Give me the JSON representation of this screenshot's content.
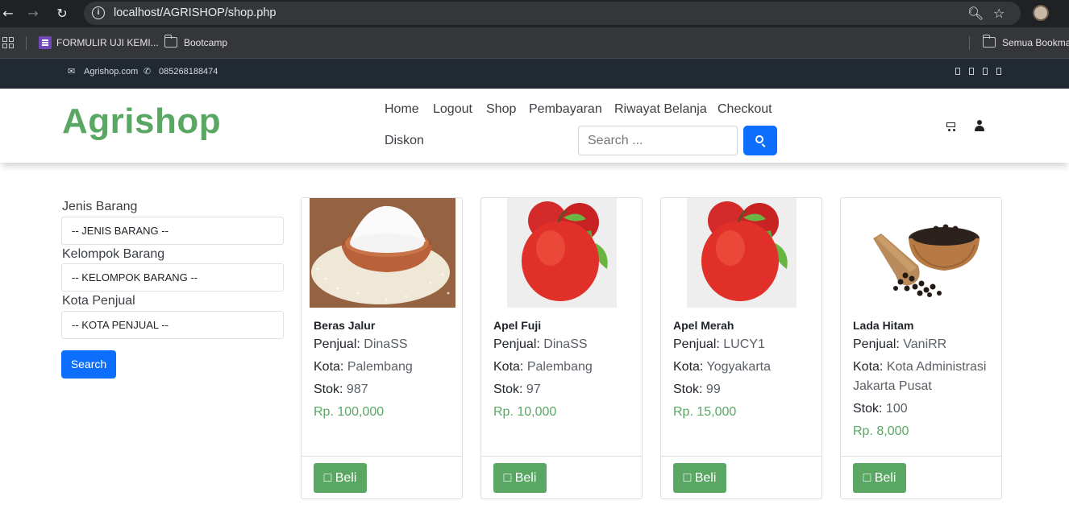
{
  "browser": {
    "url": "localhost/AGRISHOP/shop.php",
    "bookmarks": [
      "FORMULIR UJI KEMI...",
      "Bootcamp"
    ],
    "all_bookmarks": "Semua Bookma"
  },
  "topbar": {
    "email": "Agrishop.com",
    "phone": "085268188474"
  },
  "header": {
    "brand": "Agrishop",
    "nav": [
      "Home",
      "Logout",
      "Shop",
      "Pembayaran",
      "Riwayat Belanja",
      "Checkout",
      "Diskon"
    ],
    "search_placeholder": "Search ..."
  },
  "filters": {
    "jenis_label": "Jenis Barang",
    "jenis_value": "-- JENIS BARANG --",
    "kelompok_label": "Kelompok Barang",
    "kelompok_value": "-- KELOMPOK BARANG --",
    "kota_label": "Kota Penjual",
    "kota_value": "-- KOTA PENJUAL --",
    "search_button": "Search"
  },
  "products": [
    {
      "name": "Beras Jalur",
      "seller_label": "Penjual:",
      "seller": "DinaSS",
      "city_label": "Kota:",
      "city": "Palembang",
      "stock_label": "Stok:",
      "stock": "987",
      "price": "Rp. 100,000",
      "buy": "□ Beli"
    },
    {
      "name": "Apel Fuji",
      "seller_label": "Penjual:",
      "seller": "DinaSS",
      "city_label": "Kota:",
      "city": "Palembang",
      "stock_label": "Stok:",
      "stock": "97",
      "price": "Rp. 10,000",
      "buy": "□ Beli"
    },
    {
      "name": "Apel Merah",
      "seller_label": "Penjual:",
      "seller": "LUCY1",
      "city_label": "Kota:",
      "city": "Yogyakarta",
      "stock_label": "Stok:",
      "stock": "99",
      "price": "Rp. 15,000",
      "buy": "□ Beli"
    },
    {
      "name": "Lada Hitam",
      "seller_label": "Penjual:",
      "seller": "VaniRR",
      "city_label": "Kota:",
      "city": "Kota Administrasi Jakarta Pusat",
      "stock_label": "Stok:",
      "stock": "100",
      "price": "Rp. 8,000",
      "buy": "□ Beli"
    }
  ],
  "colors": {
    "brand": "#5aa764",
    "primary": "#0d6efd",
    "topbar": "#212933"
  }
}
